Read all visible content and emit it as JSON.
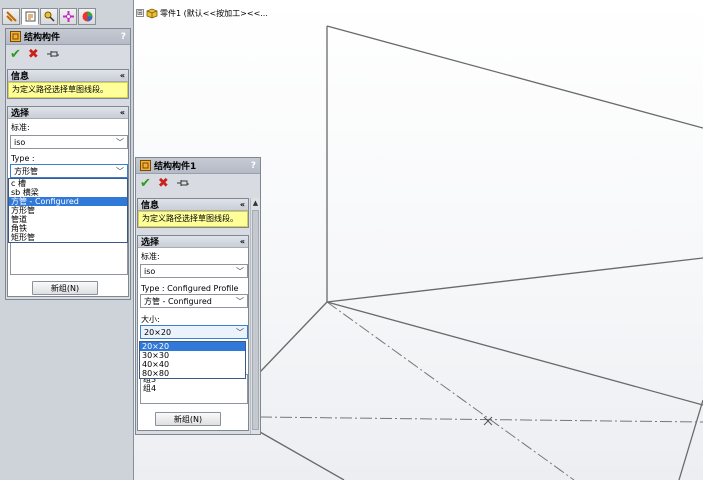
{
  "tree": {
    "expander": "⊞",
    "part_label": "零件1 (默认<<按加工><<..."
  },
  "left_panel": {
    "tabs": [
      "feature-manager-icon",
      "property-manager-icon",
      "configuration-manager-icon",
      "dimxpert-icon",
      "display-manager-icon"
    ],
    "title": "结构构件",
    "help": "?",
    "info_header": "信息",
    "info_message": "为定义路径选择草图线段。",
    "selection_header": "选择",
    "standard_label": "标准:",
    "standard_value": "iso",
    "type_label": "Type :",
    "type_value": "方形管",
    "type_options": [
      "c 槽",
      "sb 横梁",
      "方管 - Configured",
      "方形管",
      "管道",
      "角铁",
      "矩形管"
    ],
    "type_selected_index": 2,
    "new_group_button": "新组(N)"
  },
  "float_panel": {
    "title": "结构构件1",
    "help": "?",
    "info_header": "信息",
    "info_message": "为定义路径选择草图线段。",
    "selection_header": "选择",
    "standard_label": "标准:",
    "standard_value": "iso",
    "type_label": "Type : Configured Profile",
    "type_value": "方管 - Configured",
    "size_label": "大小:",
    "size_value": "20×20",
    "size_options": [
      "20×20",
      "30×30",
      "40×40",
      "80×80"
    ],
    "size_selected_index": 0,
    "groups_visible": [
      "组3",
      "组4"
    ],
    "new_group_button": "新组(N)"
  },
  "colors": {
    "accent_blue": "#3179d8",
    "info_yellow": "#ffff99",
    "ok_green": "#2d9b1c",
    "cancel_red": "#c8221b"
  }
}
